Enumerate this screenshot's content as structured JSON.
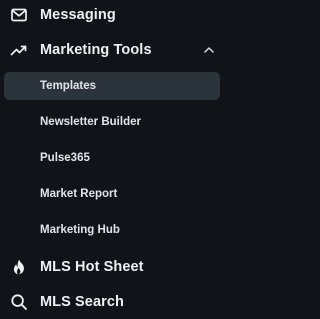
{
  "nav": {
    "messaging": {
      "label": "Messaging",
      "icon": "envelope-icon"
    },
    "marketing_tools": {
      "label": "Marketing Tools",
      "icon": "trending-up-icon",
      "expanded": true,
      "sub_items": [
        {
          "label": "Templates",
          "active": true
        },
        {
          "label": "Newsletter Builder",
          "active": false
        },
        {
          "label": "Pulse365",
          "active": false
        },
        {
          "label": "Market Report",
          "active": false
        },
        {
          "label": "Marketing Hub",
          "active": false
        }
      ]
    },
    "mls_hot_sheet": {
      "label": "MLS Hot Sheet",
      "icon": "flame-icon"
    },
    "mls_search": {
      "label": "MLS Search",
      "icon": "search-icon"
    }
  },
  "colors": {
    "background": "#101418",
    "active_item_bg": "#2b333b",
    "text": "#e9ebee"
  }
}
